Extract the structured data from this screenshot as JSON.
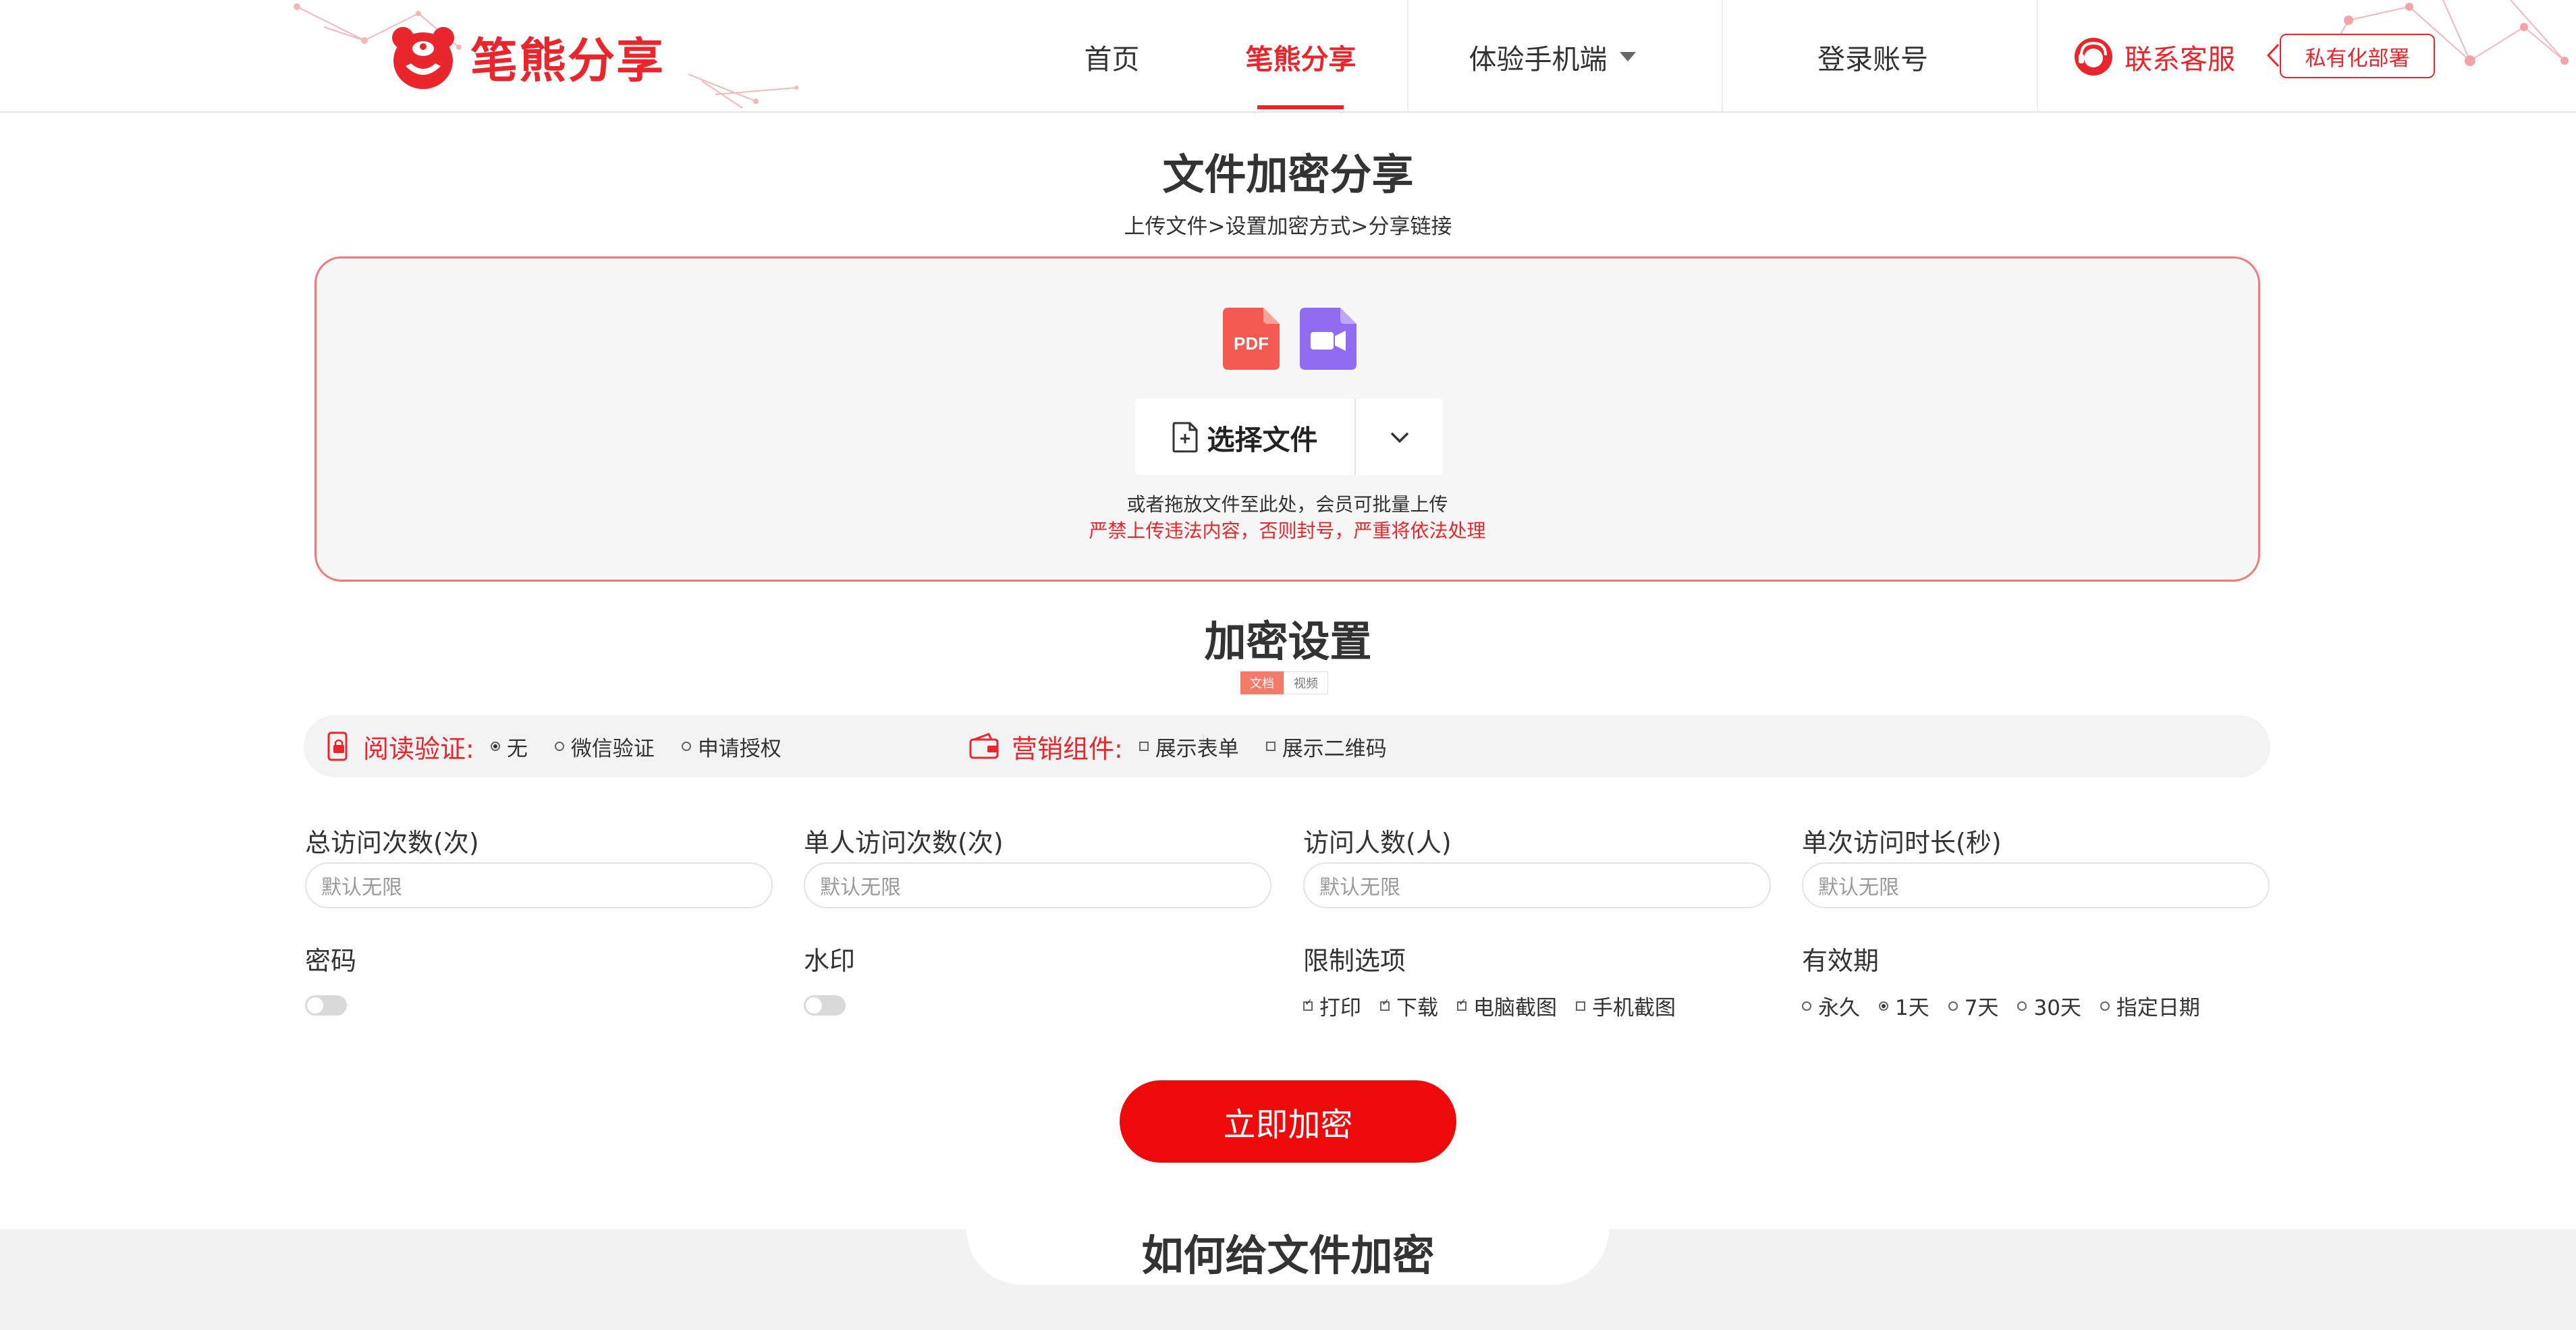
{
  "header": {
    "logo_text": "笔熊分享",
    "nav": [
      {
        "label": "首页"
      },
      {
        "label": "笔熊分享"
      },
      {
        "label": "体验手机端"
      },
      {
        "label": "登录账号"
      }
    ],
    "contact_label": "联系客服",
    "private_deploy_label": "私有化部署"
  },
  "page": {
    "title": "文件加密分享",
    "steps": "上传文件>设置加密方式>分享链接"
  },
  "upload": {
    "file_icons": [
      "pdf-icon",
      "video-icon"
    ],
    "pdf_label": "PDF",
    "choose_label": "选择文件",
    "drag_hint": "或者拖放文件至此处，会员可批量上传",
    "warning": "严禁上传违法内容，否则封号，严重将依法处理"
  },
  "settings": {
    "title": "加密设置",
    "tabs": [
      {
        "label": "文档",
        "active": true
      },
      {
        "label": "视频",
        "active": false
      }
    ],
    "read_verify": {
      "label": "阅读验证:",
      "options": [
        {
          "label": "无",
          "selected": true
        },
        {
          "label": "微信验证",
          "selected": false
        },
        {
          "label": "申请授权",
          "selected": false
        }
      ]
    },
    "marketing": {
      "label": "营销组件:",
      "options": [
        {
          "label": "展示表单",
          "checked": false
        },
        {
          "label": "展示二维码",
          "checked": false
        }
      ]
    },
    "fields": [
      {
        "label": "总访问次数(次)",
        "placeholder": "默认无限"
      },
      {
        "label": "单人访问次数(次)",
        "placeholder": "默认无限"
      },
      {
        "label": "访问人数(人)",
        "placeholder": "默认无限"
      },
      {
        "label": "单次访问时长(秒)",
        "placeholder": "默认无限"
      }
    ],
    "password": {
      "label": "密码",
      "enabled": false
    },
    "watermark": {
      "label": "水印",
      "enabled": false
    },
    "restrictions": {
      "label": "限制选项",
      "options": [
        {
          "label": "打印",
          "checked": true
        },
        {
          "label": "下载",
          "checked": true
        },
        {
          "label": "电脑截图",
          "checked": true
        },
        {
          "label": "手机截图",
          "checked": false
        }
      ]
    },
    "validity": {
      "label": "有效期",
      "options": [
        {
          "label": "永久",
          "selected": false
        },
        {
          "label": "1天",
          "selected": true
        },
        {
          "label": "7天",
          "selected": false
        },
        {
          "label": "30天",
          "selected": false
        },
        {
          "label": "指定日期",
          "selected": false
        }
      ]
    },
    "submit_label": "立即加密"
  },
  "howto": {
    "title": "如何给文件加密"
  },
  "colors": {
    "brand_red": "#e8262c",
    "button_red": "#ee0a0a",
    "pdf_red": "#f25a52",
    "video_purple": "#8f6cf0"
  }
}
